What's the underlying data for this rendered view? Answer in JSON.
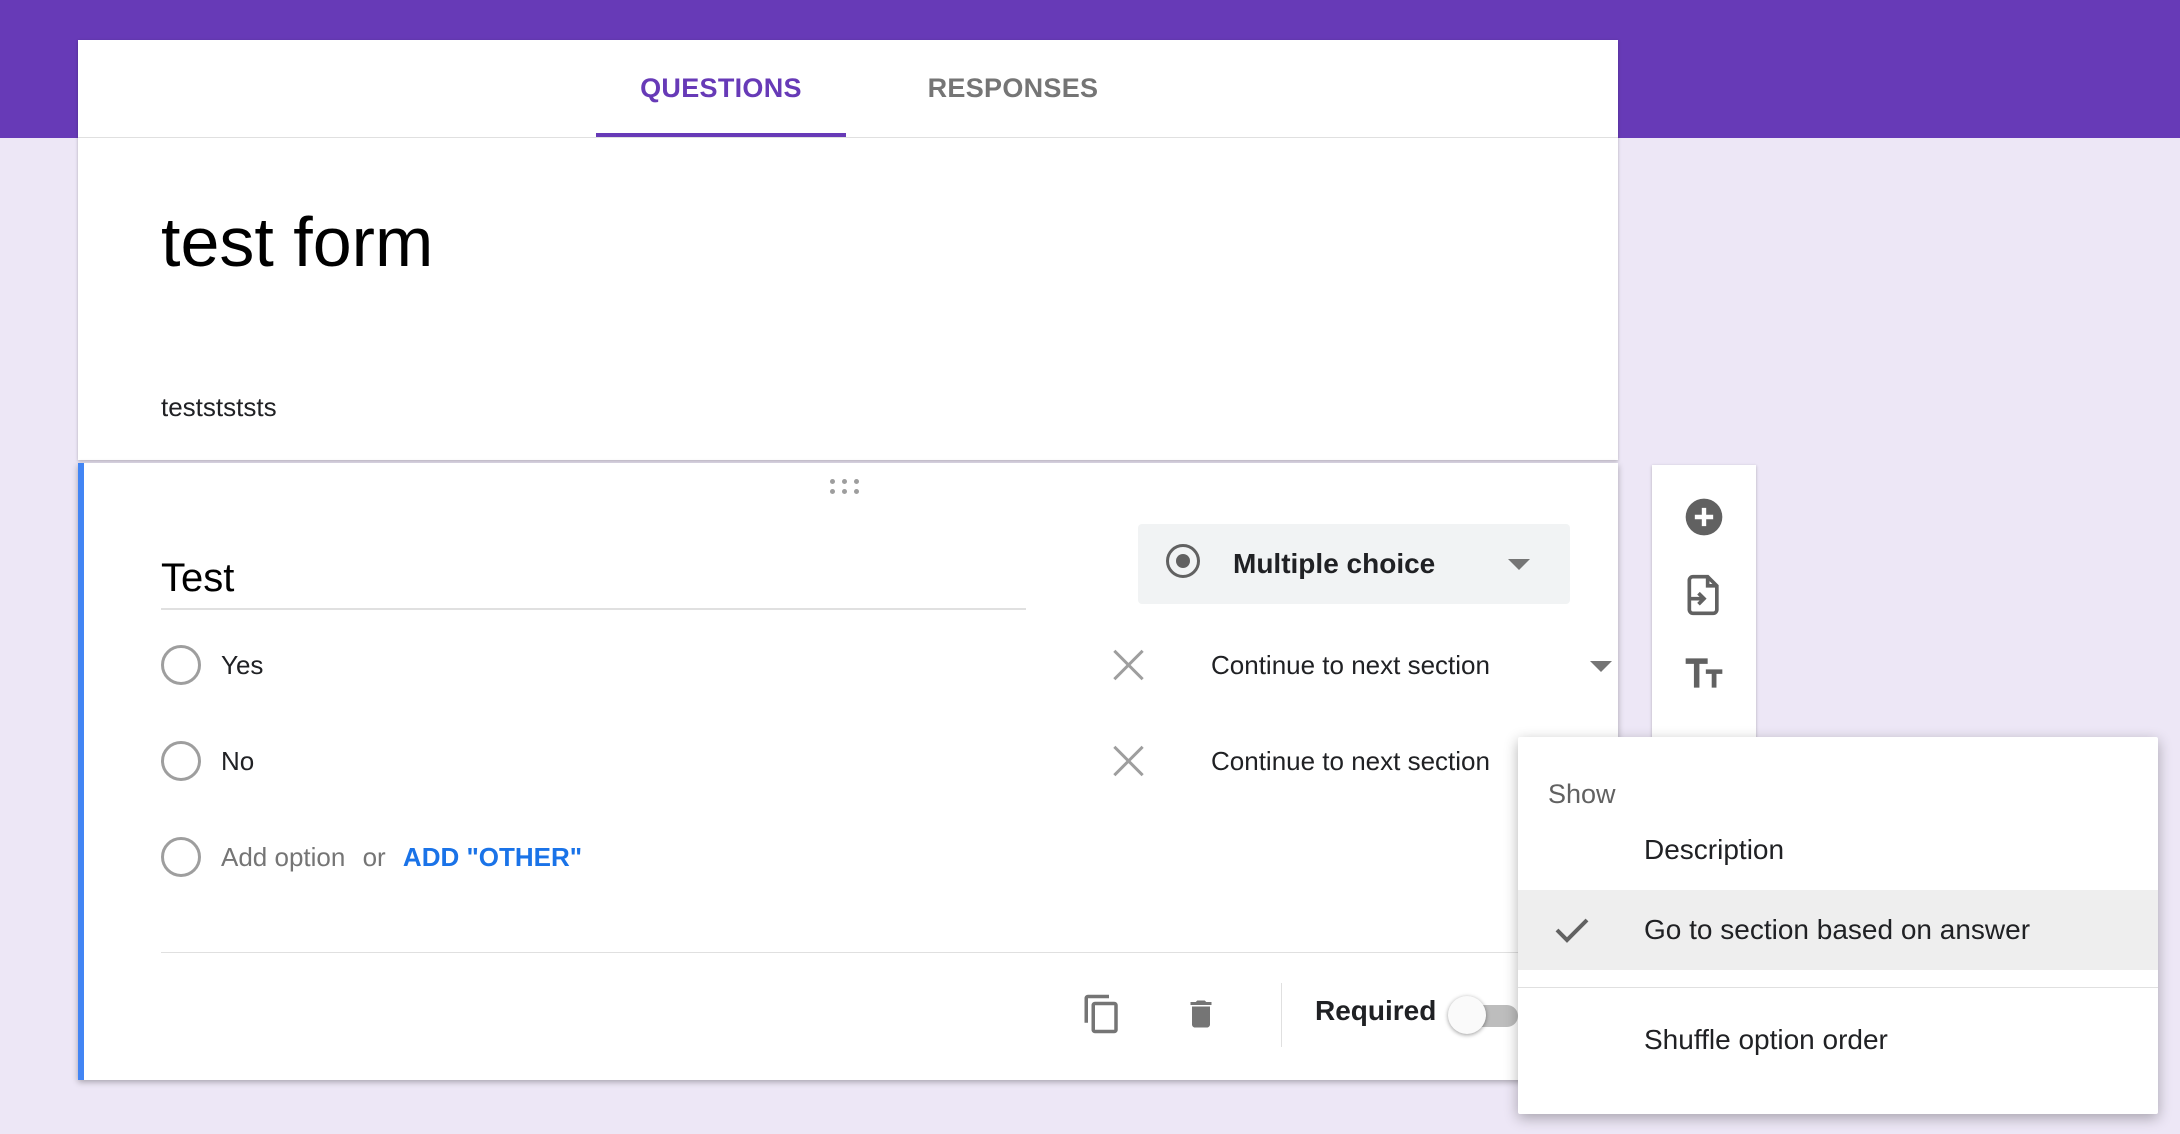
{
  "tabs": [
    {
      "label": "QUESTIONS",
      "active": true
    },
    {
      "label": "RESPONSES",
      "active": false
    }
  ],
  "form": {
    "title": "test form",
    "description": "teststststs"
  },
  "question": {
    "title": "Test",
    "type_label": "Multiple choice",
    "type_icon": "radio-button-icon",
    "options": [
      {
        "label": "Yes",
        "goto": "Continue to next section"
      },
      {
        "label": "No",
        "goto": "Continue to next section"
      }
    ],
    "add_option_label": "Add option",
    "or_label": "or",
    "add_other_label": "ADD \"OTHER\"",
    "required_label": "Required",
    "required_on": false
  },
  "side_toolbar": {
    "icons": [
      "add-question-icon",
      "import-questions-icon",
      "add-title-icon"
    ]
  },
  "menu": {
    "header": "Show",
    "items": [
      {
        "label": "Description",
        "checked": false
      },
      {
        "label": "Go to section based on answer",
        "checked": true
      },
      {
        "label": "Shuffle option order",
        "checked": false
      }
    ]
  },
  "colors": {
    "brand": "#673ab7",
    "accent_left_bar": "#4285f4",
    "link": "#1a73e8",
    "page_bg": "#ede7f6"
  }
}
